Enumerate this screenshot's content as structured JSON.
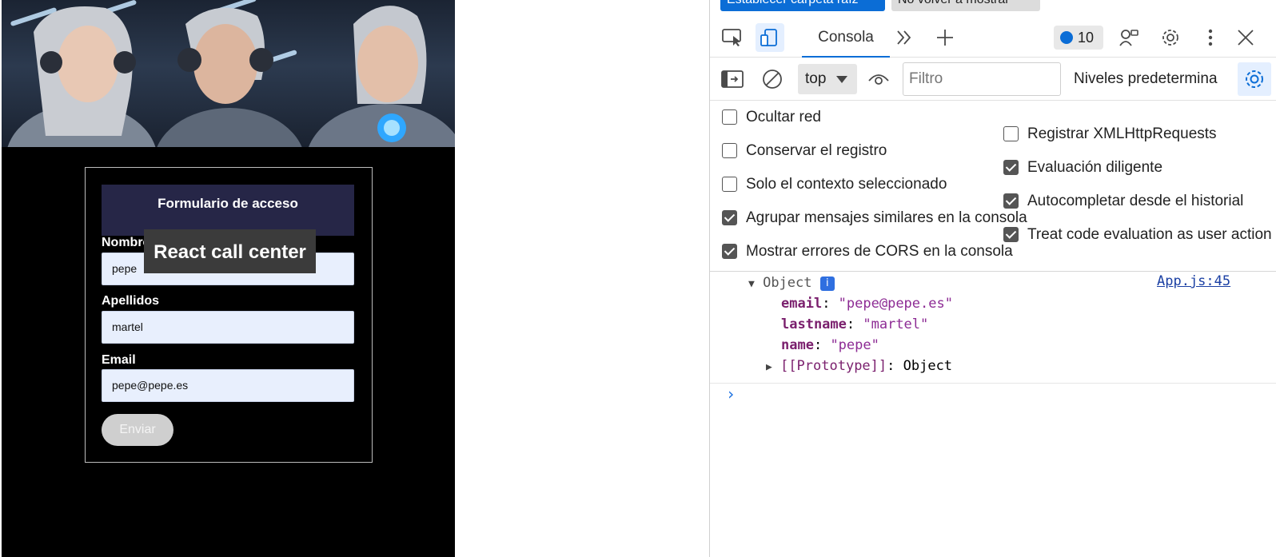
{
  "app": {
    "hero_alt": "Three armored call center agents with headsets",
    "form_title": "Formulario de acceso",
    "fields": [
      {
        "label": "Nombre",
        "value": "pepe"
      },
      {
        "label": "Apellidos",
        "value": "martel"
      },
      {
        "label": "Email",
        "value": "pepe@pepe.es"
      }
    ],
    "submit_label": "Enviar",
    "tooltip": "React call center"
  },
  "devtools": {
    "infobar": {
      "primary": "Establecer carpeta raíz",
      "secondary": "No volver a mostrar"
    },
    "tabs": {
      "active": "Consola"
    },
    "issues_count": "10",
    "toolbar": {
      "context": "top",
      "filter_placeholder": "Filtro",
      "levels": "Niveles predeterminados"
    },
    "settings": {
      "left": [
        {
          "label": "Ocultar red",
          "checked": false
        },
        {
          "label": "Conservar el registro",
          "checked": false
        },
        {
          "label": "Solo el contexto seleccionado",
          "checked": false
        },
        {
          "label": "Agrupar mensajes similares en la consola",
          "checked": true
        },
        {
          "label": "Mostrar errores de CORS en la consola",
          "checked": true
        }
      ],
      "right": [
        {
          "label": "Registrar XMLHttpRequests",
          "checked": false
        },
        {
          "label": "Evaluación diligente",
          "checked": true
        },
        {
          "label": "Autocompletar desde el historial",
          "checked": true
        },
        {
          "label": "Treat code evaluation as user action",
          "checked": true
        }
      ]
    },
    "console": {
      "object_label": "Object",
      "info_badge": "i",
      "source": "App.js:45",
      "props": [
        {
          "key": "email",
          "value": "\"pepe@pepe.es\""
        },
        {
          "key": "lastname",
          "value": "\"martel\""
        },
        {
          "key": "name",
          "value": "\"pepe\""
        }
      ],
      "prototype_key": "[[Prototype]]",
      "prototype_value": "Object",
      "prompt": "›"
    },
    "colors": {
      "accent": "#0b6dd6",
      "form_header": "#262647",
      "input_bg": "#e8effd"
    }
  }
}
